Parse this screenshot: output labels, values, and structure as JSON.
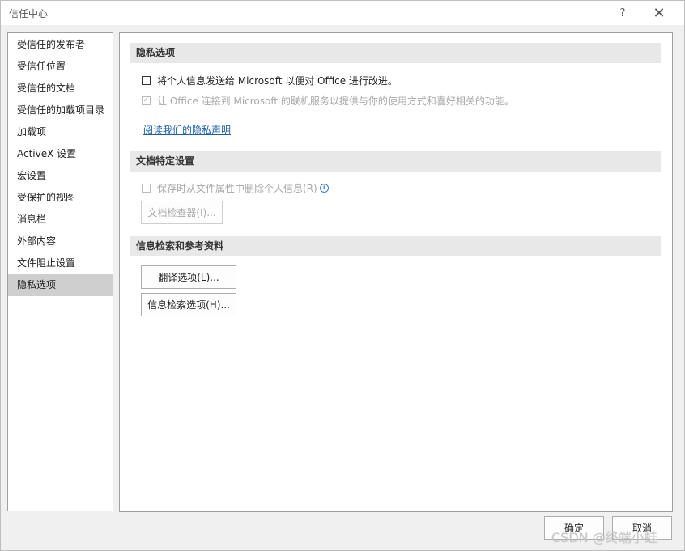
{
  "window": {
    "title": "信任中心",
    "help_label": "?",
    "close_label": "✕"
  },
  "sidebar": {
    "items": [
      {
        "label": "受信任的发布者"
      },
      {
        "label": "受信任位置"
      },
      {
        "label": "受信任的文档"
      },
      {
        "label": "受信任的加载项目录"
      },
      {
        "label": "加载项"
      },
      {
        "label": "ActiveX 设置"
      },
      {
        "label": "宏设置"
      },
      {
        "label": "受保护的视图"
      },
      {
        "label": "消息栏"
      },
      {
        "label": "外部内容"
      },
      {
        "label": "文件阻止设置"
      },
      {
        "label": "隐私选项"
      }
    ],
    "selected_index": 11
  },
  "privacy": {
    "header": "隐私选项",
    "option1": "将个人信息发送给 Microsoft 以便对 Office 进行改进。",
    "option1_checked": false,
    "option2": "让 Office 连接到 Microsoft 的联机服务以提供与你的使用方式和喜好相关的功能。",
    "option2_checked": true,
    "option2_disabled": true,
    "link": "阅读我们的隐私声明"
  },
  "document": {
    "header": "文档特定设置",
    "option": "保存时从文件属性中删除个人信息(R)",
    "option_checked": false,
    "option_disabled": true,
    "info_icon": "i",
    "inspector_button": "文档检查器(I)..."
  },
  "research": {
    "header": "信息检索和参考资料",
    "translate_button": "翻译选项(L)...",
    "research_button": "信息检索选项(H)..."
  },
  "footer": {
    "ok": "确定",
    "cancel": "取消"
  },
  "watermark": "CSDN @终端小蛙",
  "colors": {
    "selected_bg": "#cfcfcf",
    "section_bg": "#e8e8e8",
    "link": "#1f5fa8"
  }
}
